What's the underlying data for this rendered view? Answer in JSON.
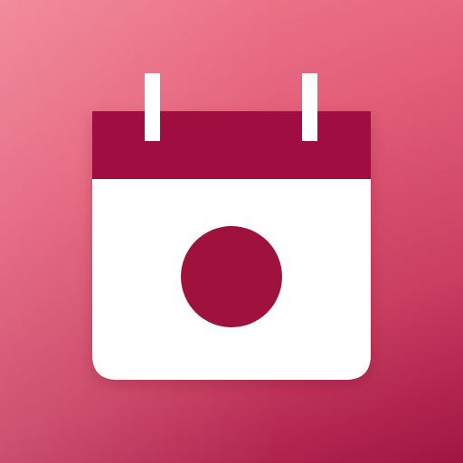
{
  "icon": {
    "name": "japan-calendar-icon",
    "colors": {
      "background_light": "#f07f92",
      "background_dark": "#a01543",
      "calendar_header": "#a0113f",
      "calendar_body": "#ffffff",
      "ring": "#ffffff",
      "sun_disc": "#a0123e"
    }
  }
}
